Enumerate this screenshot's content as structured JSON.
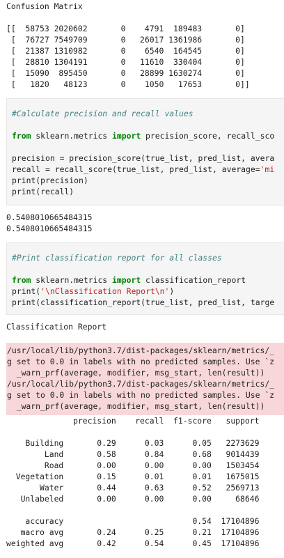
{
  "output1": {
    "title": "Confusion Matrix",
    "blank": "",
    "matrix_rows": [
      "[[  58753 2020602       0    4791  189483       0]",
      " [  76727 7549709       0   26017 1361986       0]",
      " [  21387 1310982       0    6540  164545       0]",
      " [  28810 1304191       0   11610  330404       0]",
      " [  15090  895450       0   28899 1630274       0]",
      " [   1820   48123       0    1050   17653       0]]"
    ]
  },
  "cell1": {
    "comment": "#Calculate precision and recall values",
    "import_kw1": "from",
    "import_mod": " sklearn.metrics ",
    "import_kw2": "import",
    "import_rest": " precision_score, recall_sco",
    "line_prec_a": "precision = precision_score(true_list, pred_list, avera",
    "line_rec_a": "recall = recall_score(true_list, pred_list, average=",
    "line_rec_str": "'mi",
    "line_print1": "print(precision)",
    "line_print2": "print(recall)"
  },
  "output2": {
    "precision": "0.5408010665484315",
    "recall": "0.5408010665484315"
  },
  "cell2": {
    "comment": "#Print classification report for all classes",
    "import_kw1": "from",
    "import_mod": " sklearn.metrics ",
    "import_kw2": "import",
    "import_rest": " classification_report",
    "print_a": "print(",
    "print_str": "'\\nClassification Report\\n'",
    "print_b": ")",
    "print_report": "print(classification_report(true_list, pred_list, targe"
  },
  "output3": {
    "title": "Classification Report",
    "warnings": [
      "/usr/local/lib/python3.7/dist-packages/sklearn/metrics/_",
      "g set to 0.0 in labels with no predicted samples. Use `z",
      "  _warn_prf(average, modifier, msg_start, len(result))",
      "/usr/local/lib/python3.7/dist-packages/sklearn/metrics/_",
      "g set to 0.0 in labels with no predicted samples. Use `z",
      "  _warn_prf(average, modifier, msg_start, len(result))"
    ],
    "report_lines": [
      "              precision    recall  f1-score   support",
      "",
      "    Building       0.29      0.03      0.05   2273629",
      "        Land       0.58      0.84      0.68   9014439",
      "        Road       0.00      0.00      0.00   1503454",
      "  Vegetation       0.15      0.01      0.01   1675015",
      "       Water       0.44      0.63      0.52   2569713",
      "   Unlabeled       0.00      0.00      0.00     68646",
      "",
      "    accuracy                           0.54  17104896",
      "   macro avg       0.24      0.25      0.21  17104896",
      "weighted avg       0.42      0.54      0.45  17104896"
    ]
  }
}
